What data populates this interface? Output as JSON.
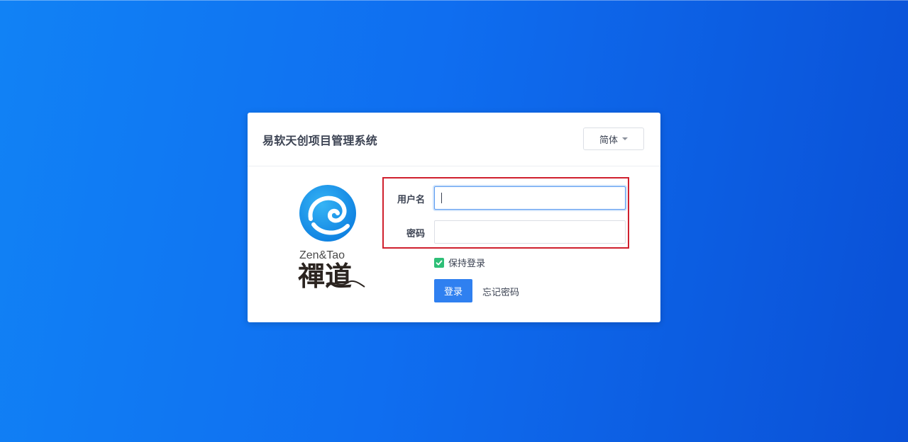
{
  "app": {
    "title": "易软天创项目管理系统"
  },
  "language": {
    "selected": "简体"
  },
  "logo": {
    "english": "Zen&Tao",
    "chinese": "禪道"
  },
  "form": {
    "username_label": "用户名",
    "username_value": "",
    "password_label": "密码",
    "password_value": "",
    "keep_login_label": "保持登录",
    "keep_login_checked": true,
    "login_label": "登录",
    "forgot_label": "忘记密码"
  },
  "colors": {
    "background_start": "#1182f5",
    "background_end": "#0a50d6",
    "primary_button": "#2f80f0",
    "checkbox": "#2ebf77",
    "highlight_border": "#d0202e"
  }
}
